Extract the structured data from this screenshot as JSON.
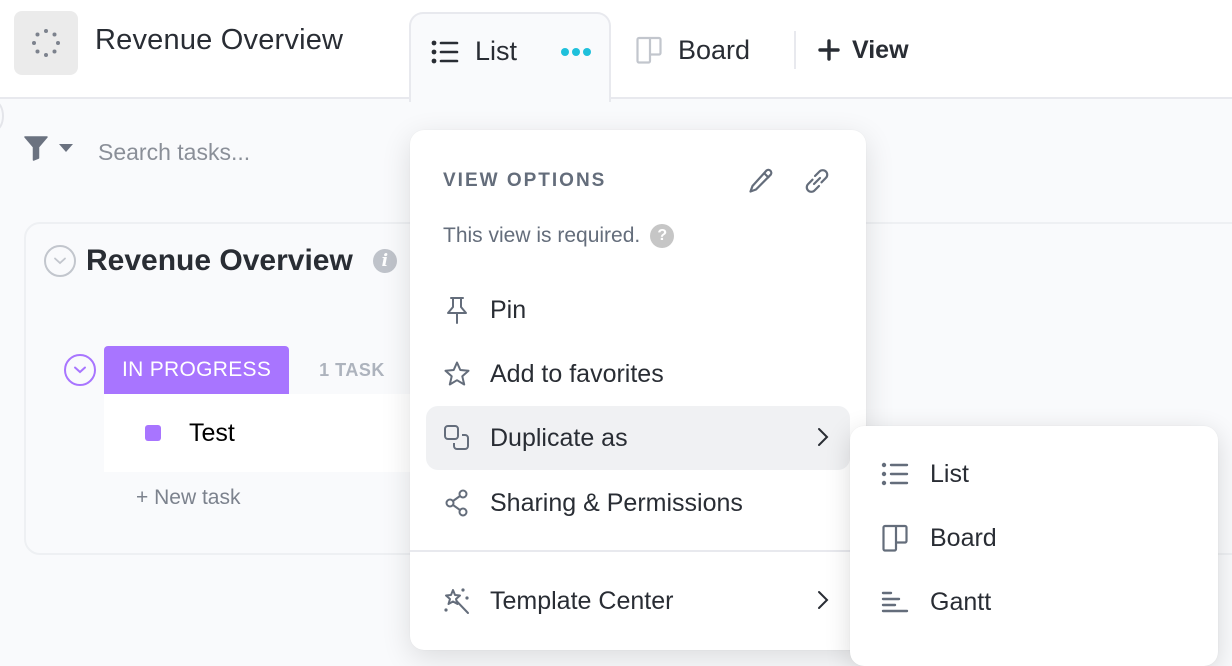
{
  "header": {
    "space_icon": "loading-dots-icon",
    "title": "Revenue Overview",
    "tabs": [
      {
        "label": "List",
        "icon": "list-icon",
        "active": true,
        "more_icon": "more-dots-icon"
      },
      {
        "label": "Board",
        "icon": "board-icon",
        "active": false
      }
    ],
    "add_view_label": "View",
    "add_view_icon": "plus-icon"
  },
  "toolbar": {
    "filter_icon": "filter-icon",
    "search_placeholder": "Search tasks...",
    "search_value": ""
  },
  "list": {
    "title": "Revenue Overview",
    "info_icon": "info-icon",
    "groups": [
      {
        "status": "IN PROGRESS",
        "status_color": "#a875ff",
        "count_label": "1 TASK",
        "tasks": [
          {
            "name": "Test",
            "status_color": "#a875ff"
          }
        ],
        "new_task_label": "+ New task"
      }
    ]
  },
  "view_options_menu": {
    "heading": "VIEW OPTIONS",
    "edit_icon": "pencil-icon",
    "link_icon": "link-icon",
    "subtext": "This view is required.",
    "help_icon": "question-icon",
    "items": [
      {
        "label": "Pin",
        "icon": "pin-icon"
      },
      {
        "label": "Add to favorites",
        "icon": "star-icon"
      },
      {
        "label": "Duplicate as",
        "icon": "duplicate-icon",
        "has_submenu": true,
        "active": true
      },
      {
        "label": "Sharing & Permissions",
        "icon": "share-icon"
      },
      {
        "label": "Template Center",
        "icon": "magic-wand-icon",
        "has_submenu": true
      }
    ]
  },
  "duplicate_submenu": {
    "items": [
      {
        "label": "List",
        "icon": "list-icon"
      },
      {
        "label": "Board",
        "icon": "board-icon"
      },
      {
        "label": "Gantt",
        "icon": "gantt-icon"
      }
    ]
  },
  "colors": {
    "accent_cyan": "#1fc0db",
    "status_purple": "#a875ff",
    "text_primary": "#292d34",
    "text_muted": "#646d7b"
  }
}
